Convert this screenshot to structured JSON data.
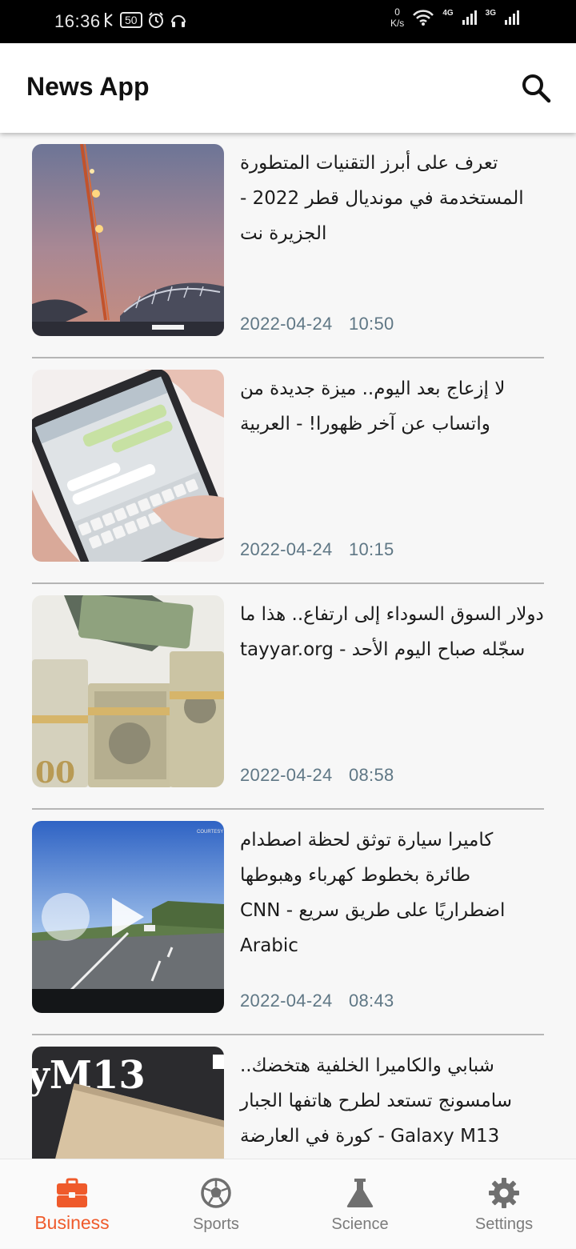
{
  "status_bar": {
    "time": "16:36",
    "battery": "50",
    "net_speed_value": "0",
    "net_speed_unit": "K/s",
    "signal_1": "4G",
    "signal_2": "3G"
  },
  "app_bar": {
    "title": "News App",
    "search_icon": "search-icon"
  },
  "articles": [
    {
      "headline": "تعرف على أبرز التقنيات المتطورة المستخدمة في مونديال قطر 2022 - الجزيرة نت",
      "date": "2022-04-24",
      "time": "10:50",
      "image": "stadium-crane-dusk"
    },
    {
      "headline": "لا إزعاج بعد اليوم.. ميزة جديدة من واتساب عن آخر ظهورا! - العربية",
      "date": "2022-04-24",
      "time": "10:15",
      "image": "hand-phone-messaging"
    },
    {
      "headline": "دولار السوق السوداء إلى ارتفاع.. هذا ما سجّله صباح اليوم الأحد - tayyar.org",
      "date": "2022-04-24",
      "time": "08:58",
      "image": "dollar-bundles"
    },
    {
      "headline": "كاميرا سيارة توثق لحظة اصطدام طائرة بخطوط كهرباء وهبوطها اضطراريًا على طريق سريع - CNN Arabic",
      "date": "2022-04-24",
      "time": "08:43",
      "image": "dashcam-highway-video",
      "image_caption": "COURTESY"
    },
    {
      "headline": "شبابي والكاميرا الخلفية هتخضك.. سامسونج تستعد لطرح هاتفها الجبار Galaxy M13 - كورة في العارضة",
      "date": "",
      "time": "",
      "image": "samsung-galaxy-m13-box",
      "image_text": "yM13"
    }
  ],
  "bottom_nav": [
    {
      "label": "Business",
      "icon": "briefcase-icon",
      "active": true
    },
    {
      "label": "Sports",
      "icon": "soccer-ball-icon",
      "active": false
    },
    {
      "label": "Science",
      "icon": "flask-icon",
      "active": false
    },
    {
      "label": "Settings",
      "icon": "gear-icon",
      "active": false
    }
  ],
  "colors": {
    "accent": "#ef5a2b",
    "meta_text": "#5f7785",
    "inactive_nav": "#7b7b7b"
  }
}
